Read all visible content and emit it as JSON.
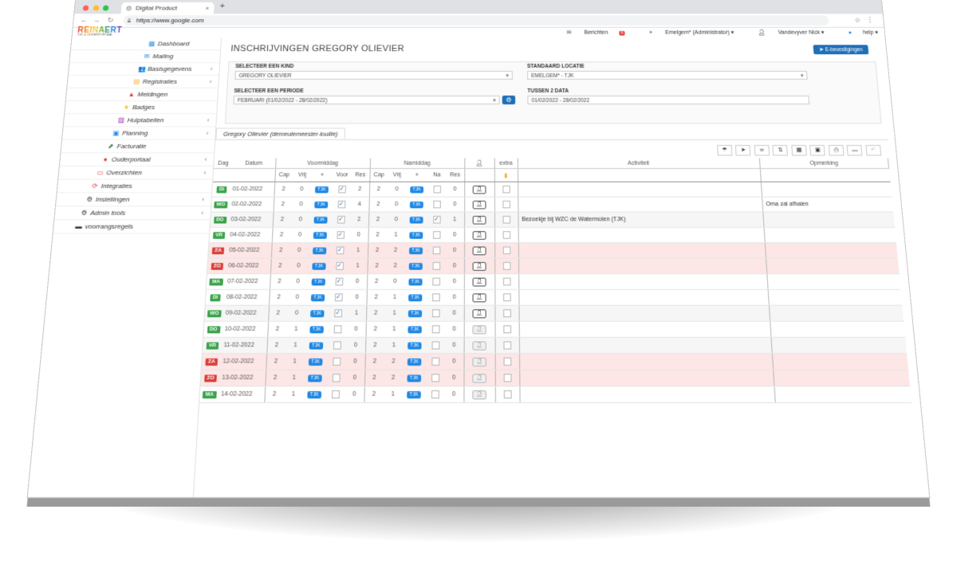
{
  "browser": {
    "tab_title": "Digital Product",
    "tab_icon": "globe-icon",
    "url": "https://www.google.com",
    "dot_colors": [
      "#ff5f57",
      "#febc2e",
      "#28c840"
    ]
  },
  "app": {
    "logo_text": "REINAERT",
    "logo_sub": "TJK & OUDERPORTAAL",
    "header": {
      "berichten": "Berichten",
      "berichten_count": "6",
      "location": "Emelgem* (Administrator) ▾",
      "user": "Vandevyver Nick ▾",
      "help": "help ▾"
    }
  },
  "sidebar": {
    "items": [
      {
        "label": "Dashboard",
        "icon": "dashboard-icon",
        "glyph": "▦",
        "color": "#1e88e5",
        "chev": ""
      },
      {
        "label": "Mailing",
        "icon": "mail-icon",
        "glyph": "✉",
        "color": "#1e88e5",
        "chev": ""
      },
      {
        "label": "Basisgegevens",
        "icon": "users-icon",
        "glyph": "👥",
        "color": "#1e88e5",
        "chev": "‹"
      },
      {
        "label": "Registraties",
        "icon": "register-icon",
        "glyph": "▤",
        "color": "#f9a825",
        "chev": "‹"
      },
      {
        "label": "Meldingen",
        "icon": "bell-icon",
        "glyph": "▲",
        "color": "#e53935",
        "chev": ""
      },
      {
        "label": "Badges",
        "icon": "badge-icon",
        "glyph": "★",
        "color": "#fbc02d",
        "chev": ""
      },
      {
        "label": "Hulptabellen",
        "icon": "table-icon",
        "glyph": "▥",
        "color": "#8e24aa",
        "chev": "‹"
      },
      {
        "label": "Planning",
        "icon": "calendar-icon",
        "glyph": "▣",
        "color": "#1e88e5",
        "chev": "‹"
      },
      {
        "label": "Facturatie",
        "icon": "invoice-icon",
        "glyph": "⬈",
        "color": "#2e7d32",
        "chev": ""
      },
      {
        "label": "Ouderportaal",
        "icon": "parents-icon",
        "glyph": "●",
        "color": "#e53935",
        "chev": "‹"
      },
      {
        "label": "Overzichten",
        "icon": "overview-icon",
        "glyph": "▭",
        "color": "#e53935",
        "chev": "‹"
      },
      {
        "label": "Integraties",
        "icon": "sync-icon",
        "glyph": "⟳",
        "color": "#e53935",
        "chev": ""
      },
      {
        "label": "Instellingen",
        "icon": "cogs-icon",
        "glyph": "⚙",
        "color": "#333333",
        "chev": "‹"
      },
      {
        "label": "Admin tools",
        "icon": "tools-icon",
        "glyph": "⚙",
        "color": "#333333",
        "chev": "‹"
      },
      {
        "label": "voorrangsregels",
        "icon": "book-icon",
        "glyph": "▬",
        "color": "#333333",
        "chev": ""
      }
    ]
  },
  "page": {
    "title": "INSCHRIJVINGEN GREGORY OLIEVIER",
    "confirm_button": "E-bevestigingen",
    "filters": {
      "kind_label": "SELECTEER EEN KIND",
      "kind_value": "GREGORY OLIEVIER",
      "locatie_label": "STANDAARD LOCATIE",
      "locatie_value": "EMELGEM* - TJK",
      "periode_label": "SELECTEER EEN PERIODE",
      "periode_value": "FEBRUARI (01/02/2022 - 28/02/2022)",
      "data_label": "TUSSEN 2 DATA",
      "data_value": "01/02/2022 - 28/02/2022"
    },
    "child_tab": "Gregory Olievier (demeulemeester-louille)"
  },
  "table": {
    "head": {
      "dag": "Dag",
      "datum": "Datum",
      "voormiddag": "Voormiddag",
      "namiddag": "Namiddag",
      "extra": "extra",
      "activiteit": "Activiteit",
      "opmerking": "Opmerking",
      "cap": "Cap",
      "vrij": "Vrij",
      "voor": "Voor",
      "res": "Res",
      "na": "Na"
    },
    "tag": "TJK",
    "rows": [
      {
        "day": "DI",
        "date": "01-02-2022",
        "vcap": "2",
        "vvrij": "0",
        "voor": "✓",
        "vres": "2",
        "ncap": "2",
        "nvrij": "0",
        "na": "",
        "nres": "0",
        "act": "",
        "opm": "",
        "wk": false,
        "alt": false
      },
      {
        "day": "WO",
        "date": "02-02-2022",
        "vcap": "2",
        "vvrij": "0",
        "voor": "✓",
        "vres": "4",
        "ncap": "2",
        "nvrij": "0",
        "na": "",
        "nres": "0",
        "act": "",
        "opm": "Oma zal afhalen",
        "wk": false,
        "alt": false
      },
      {
        "day": "DO",
        "date": "03-02-2022",
        "vcap": "2",
        "vvrij": "0",
        "voor": "✓",
        "vres": "2",
        "ncap": "2",
        "nvrij": "0",
        "na": "✓",
        "nres": "1",
        "act": "Bezoekje bij WZC de Watermolen (TJK)",
        "opm": "",
        "wk": false,
        "alt": true
      },
      {
        "day": "VR",
        "date": "04-02-2022",
        "vcap": "2",
        "vvrij": "0",
        "voor": "✓",
        "vres": "0",
        "ncap": "2",
        "nvrij": "1",
        "na": "",
        "nres": "0",
        "act": "",
        "opm": "",
        "wk": false,
        "alt": false
      },
      {
        "day": "ZA",
        "date": "05-02-2022",
        "vcap": "2",
        "vvrij": "0",
        "voor": "✓",
        "vres": "1",
        "ncap": "2",
        "nvrij": "2",
        "na": "",
        "nres": "0",
        "act": "",
        "opm": "",
        "wk": true,
        "alt": false
      },
      {
        "day": "ZO",
        "date": "06-02-2022",
        "vcap": "2",
        "vvrij": "0",
        "voor": "✓",
        "vres": "1",
        "ncap": "2",
        "nvrij": "2",
        "na": "",
        "nres": "0",
        "act": "",
        "opm": "",
        "wk": true,
        "alt": false
      },
      {
        "day": "MA",
        "date": "07-02-2022",
        "vcap": "2",
        "vvrij": "0",
        "voor": "✓",
        "vres": "0",
        "ncap": "2",
        "nvrij": "0",
        "na": "",
        "nres": "0",
        "act": "",
        "opm": "",
        "wk": false,
        "alt": false
      },
      {
        "day": "DI",
        "date": "08-02-2022",
        "vcap": "2",
        "vvrij": "0",
        "voor": "✓",
        "vres": "0",
        "ncap": "2",
        "nvrij": "1",
        "na": "",
        "nres": "0",
        "act": "",
        "opm": "",
        "wk": false,
        "alt": false
      },
      {
        "day": "WO",
        "date": "09-02-2022",
        "vcap": "2",
        "vvrij": "0",
        "voor": "✓",
        "vres": "1",
        "ncap": "2",
        "nvrij": "1",
        "na": "",
        "nres": "0",
        "act": "",
        "opm": "",
        "wk": false,
        "alt": true
      },
      {
        "day": "DO",
        "date": "10-02-2022",
        "vcap": "2",
        "vvrij": "1",
        "voor": "",
        "vres": "0",
        "ncap": "2",
        "nvrij": "1",
        "na": "",
        "nres": "0",
        "act": "",
        "opm": "",
        "wk": false,
        "alt": false
      },
      {
        "day": "VR",
        "date": "11-02-2022",
        "vcap": "2",
        "vvrij": "1",
        "voor": "",
        "vres": "0",
        "ncap": "2",
        "nvrij": "1",
        "na": "",
        "nres": "0",
        "act": "",
        "opm": "",
        "wk": false,
        "alt": true
      },
      {
        "day": "ZA",
        "date": "12-02-2022",
        "vcap": "2",
        "vvrij": "1",
        "voor": "",
        "vres": "0",
        "ncap": "2",
        "nvrij": "2",
        "na": "",
        "nres": "0",
        "act": "",
        "opm": "",
        "wk": true,
        "alt": false
      },
      {
        "day": "ZO",
        "date": "13-02-2022",
        "vcap": "2",
        "vvrij": "1",
        "voor": "",
        "vres": "0",
        "ncap": "2",
        "nvrij": "2",
        "na": "",
        "nres": "0",
        "act": "",
        "opm": "",
        "wk": true,
        "alt": false
      },
      {
        "day": "MA",
        "date": "14-02-2022",
        "vcap": "2",
        "vvrij": "1",
        "voor": "",
        "vres": "0",
        "ncap": "2",
        "nvrij": "1",
        "na": "",
        "nres": "0",
        "act": "",
        "opm": "",
        "wk": false,
        "alt": false
      }
    ]
  },
  "colors": {
    "accent": "#1e6fb8",
    "weekday_tag": "#3aa34a",
    "weekend_tag": "#d9403a",
    "weekend_row": "#fde6e6",
    "zero_value": "#e53935"
  }
}
